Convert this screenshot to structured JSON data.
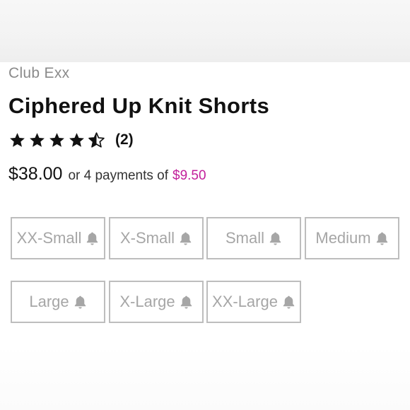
{
  "brand": "Club Exx",
  "product_title": "Ciphered Up Knit Shorts",
  "rating": {
    "value": 4.5,
    "max": 5,
    "review_count": "(2)"
  },
  "price": {
    "amount": "$38.00",
    "installment_text": "or 4 payments of",
    "installment_amount": "$9.50"
  },
  "sizes": [
    {
      "label": "XX-Small",
      "icon": "bell-icon"
    },
    {
      "label": "X-Small",
      "icon": "bell-icon"
    },
    {
      "label": "Small",
      "icon": "bell-icon"
    },
    {
      "label": "Medium",
      "icon": "bell-icon"
    },
    {
      "label": "Large",
      "icon": "bell-icon"
    },
    {
      "label": "X-Large",
      "icon": "bell-icon"
    },
    {
      "label": "XX-Large",
      "icon": "bell-icon"
    }
  ],
  "colors": {
    "accent": "#c21f9b",
    "unavailable_text": "#a6a6a6",
    "border": "#bdbdbd"
  }
}
